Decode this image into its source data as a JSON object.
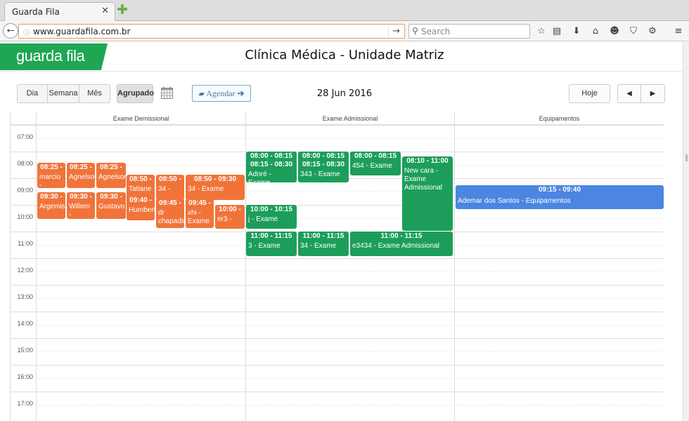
{
  "browser": {
    "tab_title": "Guarda Fila",
    "url": "www.guardafila.com.br",
    "search_placeholder": "Search"
  },
  "header": {
    "logo_text": "guarda fila",
    "title": "Clínica Médica - Unidade Matriz"
  },
  "toolbar": {
    "dia": "Dia",
    "semana": "Semana",
    "mes": "Mês",
    "agrupado": "Agrupado",
    "agendar": "Agendar",
    "date": "28 Jun 2016",
    "hoje": "Hoje",
    "prev": "◀",
    "next": "▶"
  },
  "columns": [
    "Exame Demissional",
    "Exame Admissional",
    "Equipamentos"
  ],
  "hours": [
    "07:00",
    "08:00",
    "09:00",
    "10:00",
    "11:00",
    "12:00",
    "13:00",
    "14:00",
    "15:00",
    "16:00",
    "17:00"
  ],
  "events": [
    {
      "col": 0,
      "time": "08:25 -",
      "desc": "marcio -",
      "color": "orange"
    },
    {
      "col": 0,
      "time": "08:25 -",
      "desc": "Agnelson",
      "color": "orange"
    },
    {
      "col": 0,
      "time": "08:25 -",
      "desc": "Agnelson",
      "color": "orange"
    },
    {
      "col": 0,
      "time": "08:50 -",
      "desc": "Tatiane",
      "color": "orange"
    },
    {
      "col": 0,
      "time": "08:50 -",
      "desc": "34 -",
      "color": "orange"
    },
    {
      "col": 0,
      "time": "08:50 - 09:30",
      "desc": "34 - Exame",
      "color": "orange"
    },
    {
      "col": 0,
      "time": "09:30 -",
      "desc": "Argemisa",
      "color": "orange"
    },
    {
      "col": 0,
      "time": "09:30 -",
      "desc": "Willem -",
      "color": "orange"
    },
    {
      "col": 0,
      "time": "09:30 -",
      "desc": "Gustavo",
      "color": "orange"
    },
    {
      "col": 0,
      "time": "09:40 -",
      "desc": "Humberto",
      "color": "orange"
    },
    {
      "col": 0,
      "time": "09:45 -",
      "desc": "dr chapadin",
      "color": "orange"
    },
    {
      "col": 0,
      "time": "09:45 -",
      "desc": "xhi - Exame",
      "color": "orange"
    },
    {
      "col": 0,
      "time": "10:00 -",
      "desc": "er3 -",
      "color": "orange"
    },
    {
      "col": 1,
      "time": "08:00 - 08:15\n08:15 - 08:30",
      "desc": "Adnré - Exame",
      "color": "green"
    },
    {
      "col": 1,
      "time": "08:00 - 08:15\n08:15 - 08:30",
      "desc": "343 - Exame",
      "color": "green"
    },
    {
      "col": 1,
      "time": "08:00 - 08:15",
      "desc": "454 - Exame",
      "color": "green"
    },
    {
      "col": 1,
      "time": "08:10 - 11:00",
      "desc": "New cara - Exame Admissional",
      "color": "green"
    },
    {
      "col": 1,
      "time": "10:00 - 10:15",
      "desc": "j - Exame",
      "color": "green"
    },
    {
      "col": 1,
      "time": "11:00 - 11:15",
      "desc": "3 - Exame",
      "color": "green"
    },
    {
      "col": 1,
      "time": "11:00 - 11:15",
      "desc": "34 - Exame",
      "color": "green"
    },
    {
      "col": 1,
      "time": "11:00 - 11:15",
      "desc": "e3434 - Exame Admissional",
      "color": "green"
    },
    {
      "col": 2,
      "time": "09:15 - 09:40",
      "desc": "Ademar dos Santos - Equipamentos",
      "color": "blue"
    }
  ],
  "colors": {
    "orange": "#f0743a",
    "green": "#1c9e5a",
    "blue": "#4a86e2",
    "brand": "#1fa653"
  }
}
